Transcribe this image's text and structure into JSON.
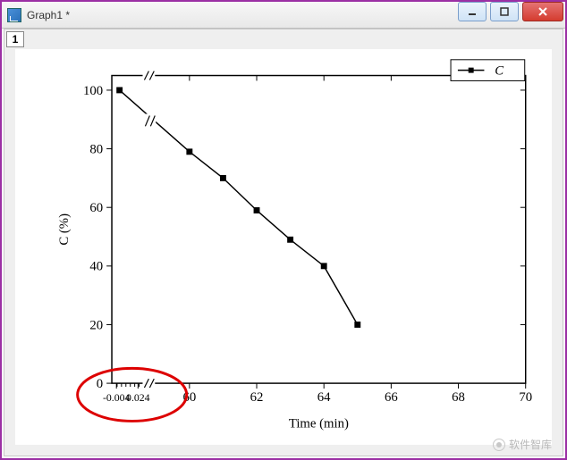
{
  "window": {
    "title": "Graph1 *"
  },
  "layer": {
    "label": "1"
  },
  "legend": {
    "series_label": "C"
  },
  "axes": {
    "xlabel": "Time (min)",
    "ylabel": "C (%)",
    "y_ticks": [
      "0",
      "20",
      "40",
      "60",
      "80",
      "100"
    ],
    "x_ticks_segment1": [
      "-0.004",
      "0.024"
    ],
    "x_ticks_segment2": [
      "60",
      "62",
      "64",
      "66",
      "68",
      "70"
    ]
  },
  "watermark": {
    "text": "软件智库"
  },
  "chart_data": {
    "type": "line",
    "title": "",
    "xlabel": "Time (min)",
    "ylabel": "C (%)",
    "ylim": [
      0,
      105
    ],
    "x_axis_break": true,
    "x_segments": [
      {
        "range": [
          -0.01,
          0.03
        ]
      },
      {
        "range": [
          59,
          70
        ]
      }
    ],
    "series": [
      {
        "name": "C",
        "marker": "square",
        "x": [
          0,
          60,
          61,
          62,
          63,
          64,
          65
        ],
        "y": [
          100,
          79,
          70,
          59,
          49,
          40,
          20
        ]
      }
    ],
    "annotations": [
      {
        "type": "ellipse",
        "color": "#d00",
        "target": "x-axis break and left-segment tick labels near origin"
      }
    ]
  }
}
